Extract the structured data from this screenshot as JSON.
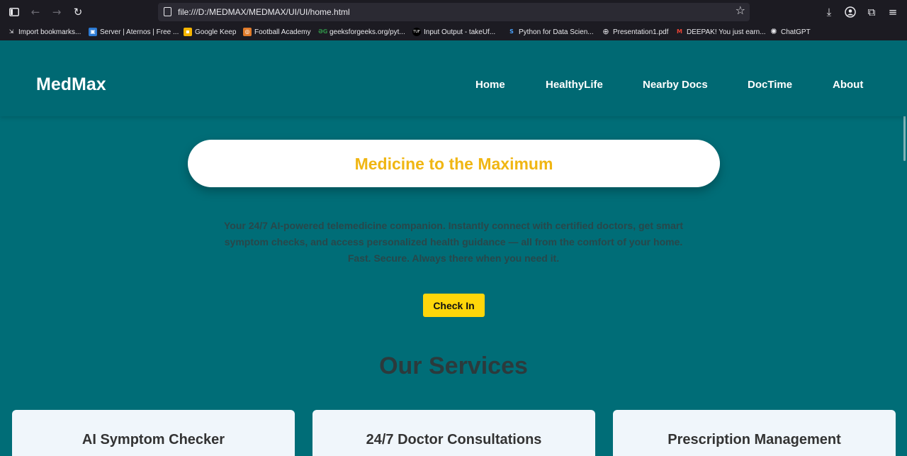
{
  "browser": {
    "url": "file:///D:/MEDMAX/MEDMAX/UI/UI/home.html",
    "bookmarks": [
      {
        "label": "Import bookmarks...",
        "icon": "import-icon"
      },
      {
        "label": "Server | Aternos | Free ...",
        "icon": "aternos-icon"
      },
      {
        "label": "Google Keep",
        "icon": "google-keep-icon"
      },
      {
        "label": "Football Academy",
        "icon": "football-academy-icon"
      },
      {
        "label": "geeksforgeeks.org/pyt...",
        "icon": "geeksforgeeks-icon"
      },
      {
        "label": "Input Output - takeUf...",
        "icon": "takeuforward-icon"
      },
      {
        "label": "Python for Data Scien...",
        "icon": "python-icon"
      },
      {
        "label": "Presentation1.pdf",
        "icon": "globe-icon"
      },
      {
        "label": "DEEPAK! You just earn...",
        "icon": "gmail-icon"
      },
      {
        "label": "ChatGPT",
        "icon": "chatgpt-icon"
      }
    ]
  },
  "navbar": {
    "logo": "MedMax",
    "links": [
      "Home",
      "HealthyLife",
      "Nearby Docs",
      "DocTime",
      "About"
    ]
  },
  "hero": {
    "title": "Medicine to the Maximum",
    "description": "Your 24/7 AI-powered telemedicine companion. Instantly connect with certified doctors, get smart symptom checks, and access personalized health guidance — all from the comfort of your home. Fast. Secure. Always there when you need it.",
    "button": "Check In"
  },
  "services": {
    "title": "Our Services",
    "cards": [
      "AI Symptom Checker",
      "24/7 Doctor Consultations",
      "Prescription Management"
    ]
  },
  "colors": {
    "page_bg": "#006d77",
    "accent_yellow": "#ffd60a",
    "title_gold": "#f0b613",
    "card_bg": "#f0f6fb"
  }
}
